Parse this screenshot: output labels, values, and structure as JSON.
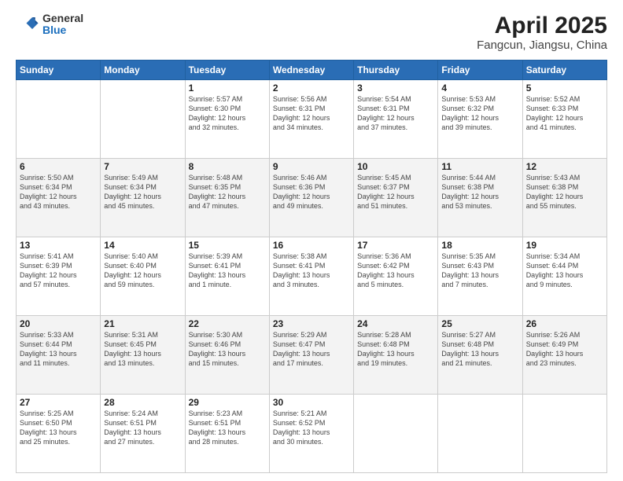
{
  "header": {
    "logo": {
      "general": "General",
      "blue": "Blue"
    },
    "title": "April 2025",
    "subtitle": "Fangcun, Jiangsu, China"
  },
  "days_of_week": [
    "Sunday",
    "Monday",
    "Tuesday",
    "Wednesday",
    "Thursday",
    "Friday",
    "Saturday"
  ],
  "weeks": [
    [
      {
        "day": "",
        "info": ""
      },
      {
        "day": "",
        "info": ""
      },
      {
        "day": "1",
        "info": "Sunrise: 5:57 AM\nSunset: 6:30 PM\nDaylight: 12 hours\nand 32 minutes."
      },
      {
        "day": "2",
        "info": "Sunrise: 5:56 AM\nSunset: 6:31 PM\nDaylight: 12 hours\nand 34 minutes."
      },
      {
        "day": "3",
        "info": "Sunrise: 5:54 AM\nSunset: 6:31 PM\nDaylight: 12 hours\nand 37 minutes."
      },
      {
        "day": "4",
        "info": "Sunrise: 5:53 AM\nSunset: 6:32 PM\nDaylight: 12 hours\nand 39 minutes."
      },
      {
        "day": "5",
        "info": "Sunrise: 5:52 AM\nSunset: 6:33 PM\nDaylight: 12 hours\nand 41 minutes."
      }
    ],
    [
      {
        "day": "6",
        "info": "Sunrise: 5:50 AM\nSunset: 6:34 PM\nDaylight: 12 hours\nand 43 minutes."
      },
      {
        "day": "7",
        "info": "Sunrise: 5:49 AM\nSunset: 6:34 PM\nDaylight: 12 hours\nand 45 minutes."
      },
      {
        "day": "8",
        "info": "Sunrise: 5:48 AM\nSunset: 6:35 PM\nDaylight: 12 hours\nand 47 minutes."
      },
      {
        "day": "9",
        "info": "Sunrise: 5:46 AM\nSunset: 6:36 PM\nDaylight: 12 hours\nand 49 minutes."
      },
      {
        "day": "10",
        "info": "Sunrise: 5:45 AM\nSunset: 6:37 PM\nDaylight: 12 hours\nand 51 minutes."
      },
      {
        "day": "11",
        "info": "Sunrise: 5:44 AM\nSunset: 6:38 PM\nDaylight: 12 hours\nand 53 minutes."
      },
      {
        "day": "12",
        "info": "Sunrise: 5:43 AM\nSunset: 6:38 PM\nDaylight: 12 hours\nand 55 minutes."
      }
    ],
    [
      {
        "day": "13",
        "info": "Sunrise: 5:41 AM\nSunset: 6:39 PM\nDaylight: 12 hours\nand 57 minutes."
      },
      {
        "day": "14",
        "info": "Sunrise: 5:40 AM\nSunset: 6:40 PM\nDaylight: 12 hours\nand 59 minutes."
      },
      {
        "day": "15",
        "info": "Sunrise: 5:39 AM\nSunset: 6:41 PM\nDaylight: 13 hours\nand 1 minute."
      },
      {
        "day": "16",
        "info": "Sunrise: 5:38 AM\nSunset: 6:41 PM\nDaylight: 13 hours\nand 3 minutes."
      },
      {
        "day": "17",
        "info": "Sunrise: 5:36 AM\nSunset: 6:42 PM\nDaylight: 13 hours\nand 5 minutes."
      },
      {
        "day": "18",
        "info": "Sunrise: 5:35 AM\nSunset: 6:43 PM\nDaylight: 13 hours\nand 7 minutes."
      },
      {
        "day": "19",
        "info": "Sunrise: 5:34 AM\nSunset: 6:44 PM\nDaylight: 13 hours\nand 9 minutes."
      }
    ],
    [
      {
        "day": "20",
        "info": "Sunrise: 5:33 AM\nSunset: 6:44 PM\nDaylight: 13 hours\nand 11 minutes."
      },
      {
        "day": "21",
        "info": "Sunrise: 5:31 AM\nSunset: 6:45 PM\nDaylight: 13 hours\nand 13 minutes."
      },
      {
        "day": "22",
        "info": "Sunrise: 5:30 AM\nSunset: 6:46 PM\nDaylight: 13 hours\nand 15 minutes."
      },
      {
        "day": "23",
        "info": "Sunrise: 5:29 AM\nSunset: 6:47 PM\nDaylight: 13 hours\nand 17 minutes."
      },
      {
        "day": "24",
        "info": "Sunrise: 5:28 AM\nSunset: 6:48 PM\nDaylight: 13 hours\nand 19 minutes."
      },
      {
        "day": "25",
        "info": "Sunrise: 5:27 AM\nSunset: 6:48 PM\nDaylight: 13 hours\nand 21 minutes."
      },
      {
        "day": "26",
        "info": "Sunrise: 5:26 AM\nSunset: 6:49 PM\nDaylight: 13 hours\nand 23 minutes."
      }
    ],
    [
      {
        "day": "27",
        "info": "Sunrise: 5:25 AM\nSunset: 6:50 PM\nDaylight: 13 hours\nand 25 minutes."
      },
      {
        "day": "28",
        "info": "Sunrise: 5:24 AM\nSunset: 6:51 PM\nDaylight: 13 hours\nand 27 minutes."
      },
      {
        "day": "29",
        "info": "Sunrise: 5:23 AM\nSunset: 6:51 PM\nDaylight: 13 hours\nand 28 minutes."
      },
      {
        "day": "30",
        "info": "Sunrise: 5:21 AM\nSunset: 6:52 PM\nDaylight: 13 hours\nand 30 minutes."
      },
      {
        "day": "",
        "info": ""
      },
      {
        "day": "",
        "info": ""
      },
      {
        "day": "",
        "info": ""
      }
    ]
  ]
}
